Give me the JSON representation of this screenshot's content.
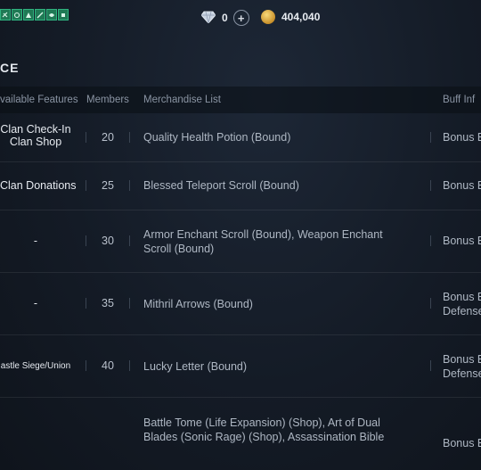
{
  "header": {
    "diamond_count": "0",
    "gold_count": "404,040",
    "section_title": "CE"
  },
  "table": {
    "columns": [
      "vailable Features",
      "Members",
      "Merchandise List",
      "Buff Inf"
    ],
    "rows": [
      {
        "feature": "Clan Check-In\nClan Shop",
        "members": "20",
        "merch": "Quality Health Potion (Bound)",
        "buff": "Bonus E"
      },
      {
        "feature": "Clan Donations",
        "members": "25",
        "merch": "Blessed Teleport Scroll (Bound)",
        "buff": "Bonus E"
      },
      {
        "feature": "-",
        "members": "30",
        "merch": "Armor Enchant Scroll (Bound), Weapon Enchant Scroll (Bound)",
        "buff": "Bonus E"
      },
      {
        "feature": "-",
        "members": "35",
        "merch": "Mithril Arrows (Bound)",
        "buff": "Bonus E\nDefense"
      },
      {
        "feature": "astle Siege/Union",
        "members": "40",
        "merch": "Lucky Letter (Bound)",
        "buff": "Bonus E\nDefense"
      },
      {
        "feature": "",
        "members": "",
        "merch": "Battle Tome (Life Expansion) (Shop), Art of Dual Blades (Sonic Rage) (Shop), Assassination Bible",
        "buff": "Bonus E"
      }
    ]
  }
}
